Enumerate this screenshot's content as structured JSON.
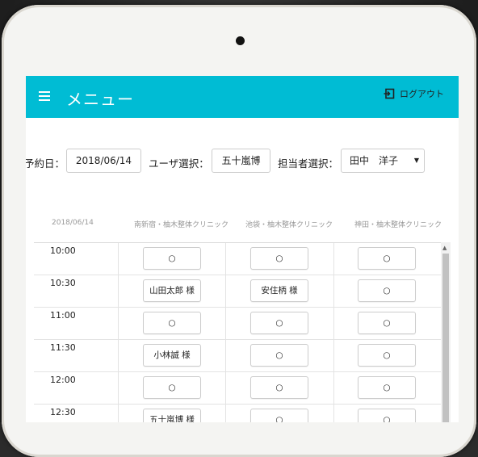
{
  "header": {
    "title": "メニュー",
    "logout_label": "ログアウト"
  },
  "filters": {
    "date_label": "予約日：",
    "date_value": "2018/06/14",
    "user_label": "ユーザ選択：",
    "user_value": "五十嵐博",
    "staff_label": "担当者選択：",
    "staff_value": "田中　洋子"
  },
  "schedule": {
    "date": "2018/06/14",
    "clinics": [
      "南新宿・柚木整体クリニック",
      "池袋・柚木整体クリニック",
      "神田・柚木整体クリニック"
    ],
    "rows": [
      {
        "time": "10:00",
        "slots": [
          "○",
          "○",
          "○"
        ]
      },
      {
        "time": "10:30",
        "slots": [
          "山田太郎 様",
          "安住柄 様",
          "○"
        ]
      },
      {
        "time": "11:00",
        "slots": [
          "○",
          "○",
          "○"
        ]
      },
      {
        "time": "11:30",
        "slots": [
          "小林誠 様",
          "○",
          "○"
        ]
      },
      {
        "time": "12:00",
        "slots": [
          "○",
          "○",
          "○"
        ]
      },
      {
        "time": "12:30",
        "slots": [
          "五十嵐博 様",
          "○",
          "○"
        ]
      }
    ]
  },
  "colors": {
    "appbar": "#00bcd4"
  },
  "icons": {
    "menu": "hamburger-icon",
    "logout": "logout-icon"
  }
}
